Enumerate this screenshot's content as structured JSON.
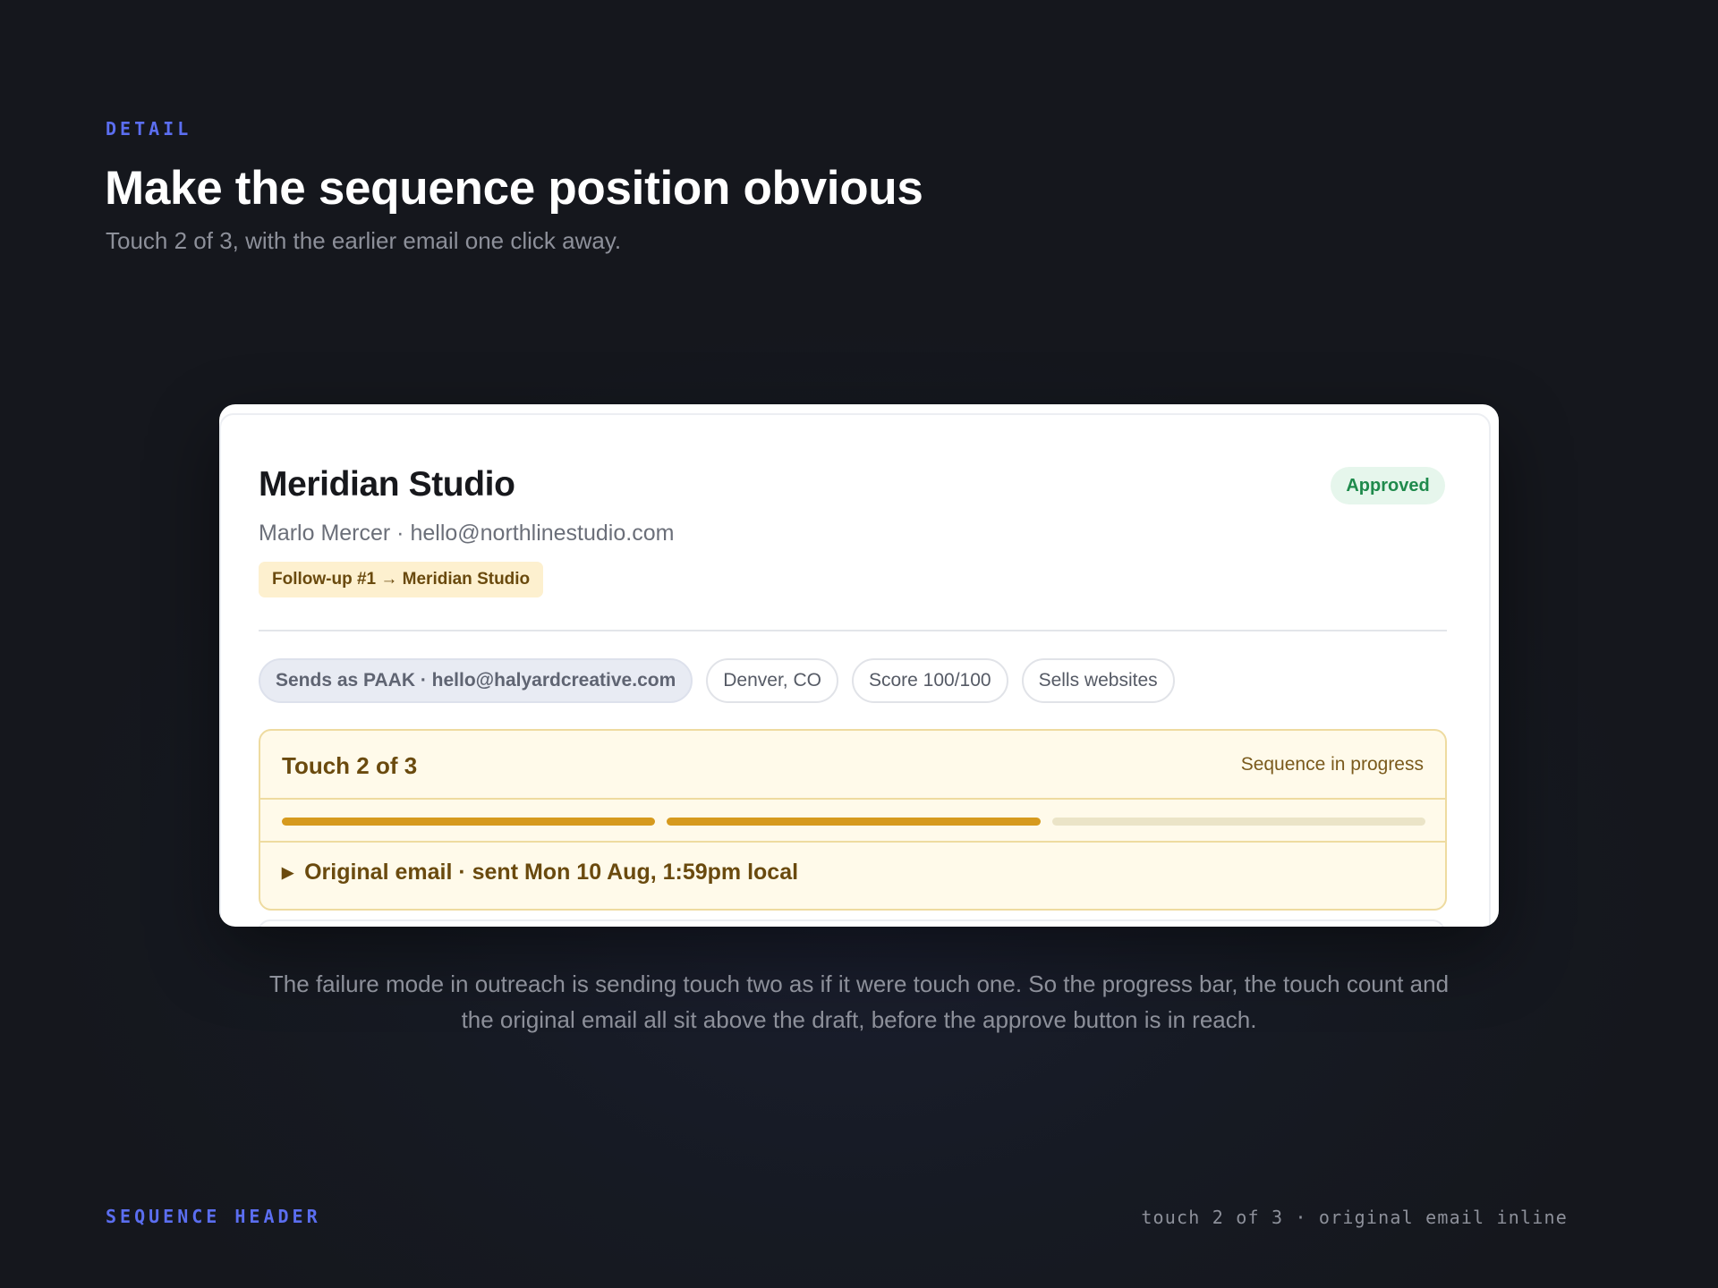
{
  "slide": {
    "eyebrow": "DETAIL",
    "title": "Make the sequence position obvious",
    "subtitle": "Touch 2 of 3, with the earlier email one click away.",
    "caption": "The failure mode in outreach is sending touch two as if it were touch one. So the progress bar, the touch count and the original email all sit above the draft, before the approve button is in reach.",
    "footer_left": "SEQUENCE HEADER",
    "footer_right": "touch 2 of 3 · original email inline"
  },
  "card": {
    "company": "Meridian Studio",
    "status_badge": "Approved",
    "contact": "Marlo Mercer · hello@northlinestudio.com",
    "followup_tag": "Follow-up #1 → Meridian Studio",
    "chips": {
      "sender": "Sends as PAAK · hello@halyardcreative.com",
      "location": "Denver, CO",
      "score": "Score 100/100",
      "offer": "Sells websites"
    },
    "sequence": {
      "count_label": "Touch 2 of 3",
      "status": "Sequence in progress",
      "current_touch": 2,
      "total_touches": 3,
      "original_email": "Original email · sent Mon 10 Aug, 1:59pm local",
      "expand_icon": "triangle-right-icon"
    }
  },
  "colors": {
    "accent": "#5b6ef0",
    "approved_bg": "#e6f6ec",
    "approved_text": "#1f8a4c",
    "sequence_bg": "#fffaea",
    "progress_done": "#d69a1e",
    "progress_pending": "#ebe4c7"
  }
}
